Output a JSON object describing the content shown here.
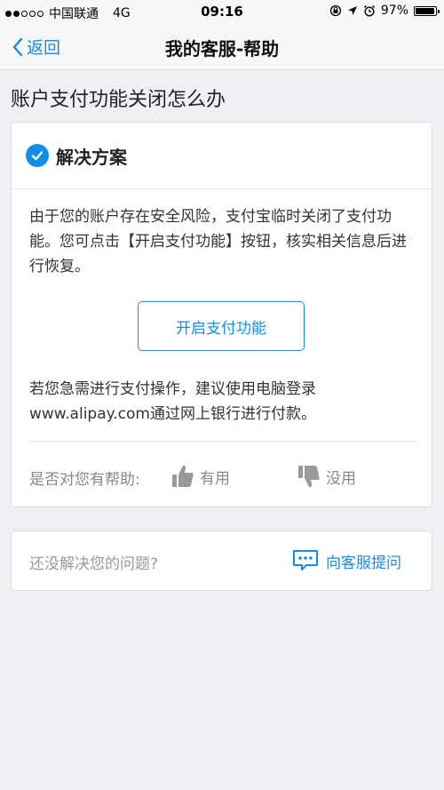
{
  "status_bar": {
    "carrier": "中国联通",
    "network": "4G",
    "time": "09:16",
    "battery": "97%",
    "battery_level": 0.97,
    "signal_bars_filled": 2,
    "signal_bars_total": 5,
    "icons": [
      "lock-rotation-icon",
      "location-icon",
      "alarm-icon",
      "battery-icon"
    ]
  },
  "nav": {
    "back_label": "返回",
    "title": "我的客服-帮助"
  },
  "page": {
    "heading": "账户支付功能关闭怎么办"
  },
  "solution": {
    "title": "解决方案",
    "paragraph1": "由于您的账户存在安全风险，支付宝临时关闭了支付功能。您可点击【开启支付功能】按钮，核实相关信息后进行恢复。",
    "button_label": "开启支付功能",
    "paragraph2": "若您急需进行支付操作，建议使用电脑登录www.alipay.com通过网上银行进行付款。",
    "feedback_label": "是否对您有帮助:",
    "useful_label": "有用",
    "useless_label": "没用"
  },
  "help": {
    "question": "还没解决您的问题?",
    "ask_label": "向客服提问"
  },
  "colors": {
    "accent": "#108ee9",
    "background": "#efeff4",
    "muted": "#888888"
  }
}
